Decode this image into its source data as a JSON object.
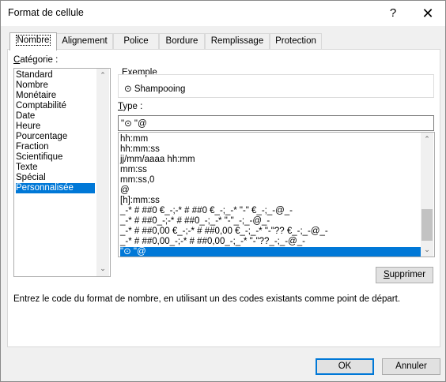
{
  "window": {
    "title": "Format de cellule",
    "help_glyph": "?",
    "close_glyph": "✕"
  },
  "tabs": [
    {
      "label": "Nombre",
      "active": true
    },
    {
      "label": "Alignement"
    },
    {
      "label": "Police"
    },
    {
      "label": "Bordure"
    },
    {
      "label": "Remplissage"
    },
    {
      "label": "Protection"
    }
  ],
  "category": {
    "label_first": "C",
    "label_rest": "atégorie :",
    "items": [
      "Standard",
      "Nombre",
      "Monétaire",
      "Comptabilité",
      "Date",
      "Heure",
      "Pourcentage",
      "Fraction",
      "Scientifique",
      "Texte",
      "Spécial",
      "Personnalisée"
    ],
    "selected": "Personnalisée"
  },
  "sample": {
    "label": "Exemple",
    "value": "⊙ Shampooing"
  },
  "type": {
    "label_first": "T",
    "label_rest": "ype :",
    "value": "\"⊙ \"@",
    "formats": [
      "hh:mm",
      "hh:mm:ss",
      "jj/mm/aaaa hh:mm",
      "mm:ss",
      "mm:ss,0",
      "@",
      "[h]:mm:ss",
      "_-* # ##0 €_-;-* # ##0 €_-;_-* \"-\" €_-;_-@_-",
      "_-* # ##0_-;-* # ##0_-;_-* \"-\"_-;_-@_-",
      "_-* # ##0,00 €_-;-* # ##0,00 €_-;_-* \"-\"?? €_-;_-@_-",
      "_-* # ##0,00_-;-* # ##0,00_-;_-* \"-\"??_-;_-@_-",
      "\"⊙ \"@"
    ],
    "selected": "\"⊙ \"@"
  },
  "buttons": {
    "delete_first": "S",
    "delete_rest": "upprimer",
    "ok": "OK",
    "cancel": "Annuler"
  },
  "help_text": "Entrez le code du format de nombre, en utilisant un des codes existants comme point de départ.",
  "colors": {
    "selection": "#0078d7",
    "dialog_bg": "#f0f0f0",
    "default_button_border": "#0078d7"
  }
}
